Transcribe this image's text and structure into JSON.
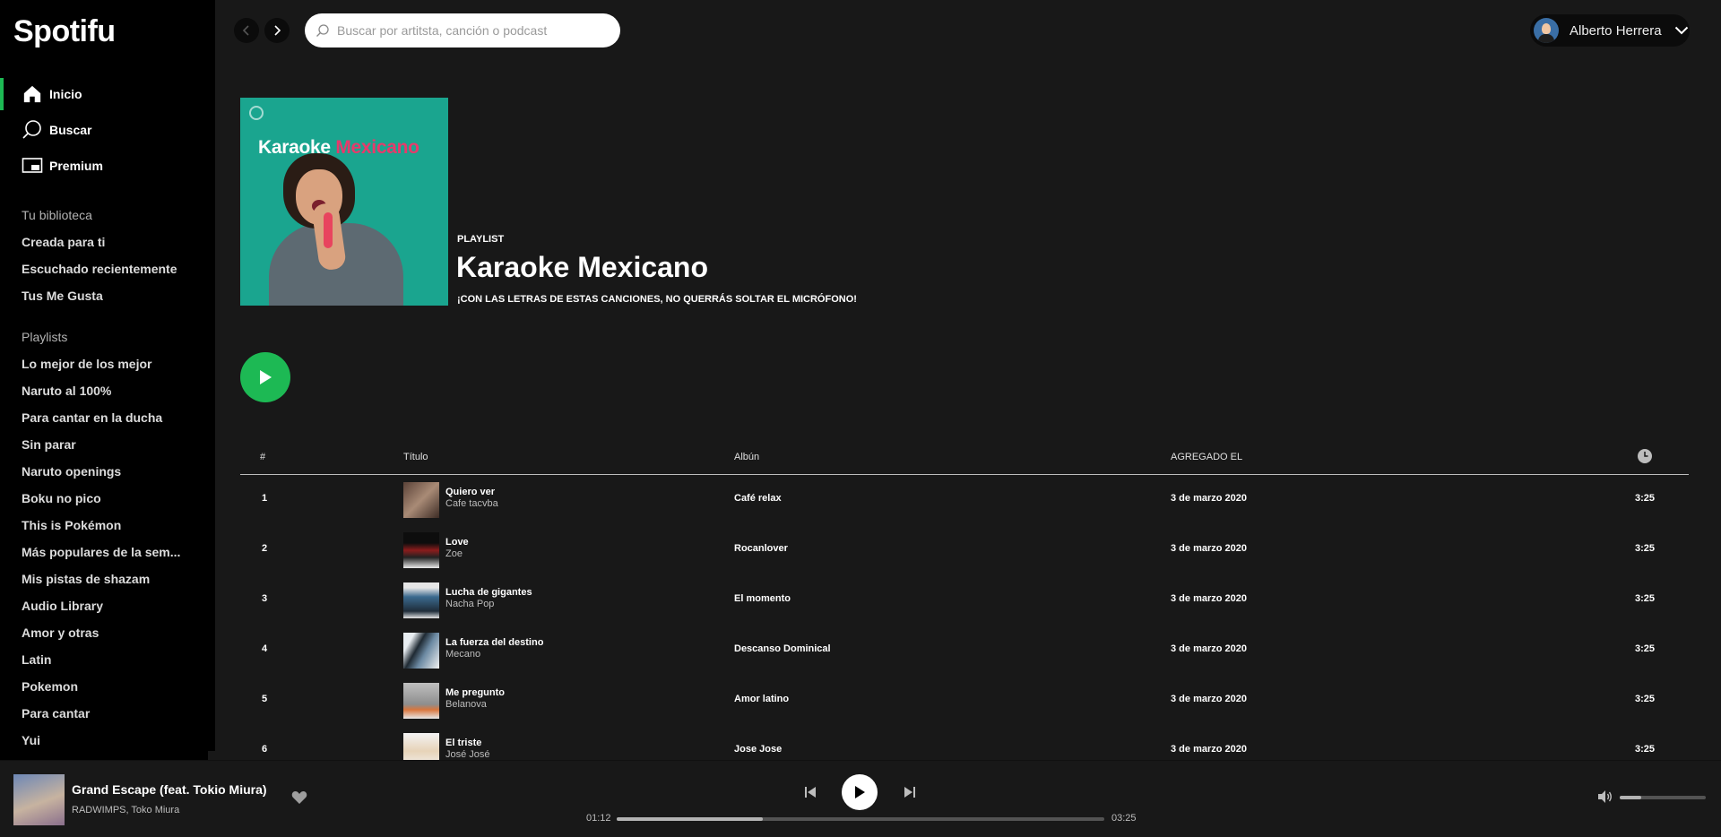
{
  "app": {
    "logo": "Spotifu"
  },
  "nav": [
    {
      "label": "Inicio",
      "icon": "home-icon",
      "active": true
    },
    {
      "label": "Buscar",
      "icon": "search-icon",
      "active": false
    },
    {
      "label": "Premium",
      "icon": "premium-icon",
      "active": false
    }
  ],
  "library": {
    "title": "Tu biblioteca",
    "items": [
      "Creada para ti",
      "Escuchado recientemente",
      "Tus Me Gusta"
    ]
  },
  "playlists": {
    "title": "Playlists",
    "items": [
      "Lo mejor de los mejor",
      "Naruto al 100%",
      "Para cantar en la ducha",
      "Sin parar",
      "Naruto openings",
      "Boku no pico",
      "This is Pokémon",
      "Más populares de la sem...",
      "Mis pistas de shazam",
      "Audio Library",
      "Amor y otras",
      "Latin",
      "Pokemon",
      "Para cantar",
      "Yui"
    ]
  },
  "search": {
    "placeholder": "Buscar por artitsta, canción o podcast"
  },
  "user": {
    "name": "Alberto Herrera"
  },
  "header": {
    "type": "PLAYLIST",
    "title": "Karaoke Mexicano",
    "description": "¡CON LAS LETRAS DE ESTAS CANCIONES, NO QUERRÁS SOLTAR EL MICRÓFONO!",
    "cover_title_white": "Karaoke",
    "cover_title_accent": "Mexicano",
    "cover_bg": "#1aa58f",
    "cover_accent": "#e63a6b"
  },
  "table": {
    "columns": {
      "num": "#",
      "title": "Título",
      "album": "Albún",
      "added": "AGREGADO EL"
    },
    "rows": [
      {
        "num": "1",
        "title": "Quiero ver",
        "artist": "Cafe tacvba",
        "album": "Café relax",
        "added": "3 de marzo 2020",
        "duration": "3:25"
      },
      {
        "num": "2",
        "title": "Love",
        "artist": "Zoe",
        "album": "Rocanlover",
        "added": "3 de marzo 2020",
        "duration": "3:25"
      },
      {
        "num": "3",
        "title": "Lucha de gigantes",
        "artist": "Nacha Pop",
        "album": "El momento",
        "added": "3 de marzo 2020",
        "duration": "3:25"
      },
      {
        "num": "4",
        "title": "La fuerza del destino",
        "artist": "Mecano",
        "album": "Descanso Dominical",
        "added": "3 de marzo 2020",
        "duration": "3:25"
      },
      {
        "num": "5",
        "title": "Me pregunto",
        "artist": "Belanova",
        "album": "Amor latino",
        "added": "3 de marzo 2020",
        "duration": "3:25"
      },
      {
        "num": "6",
        "title": "El triste",
        "artist": "José José",
        "album": "Jose Jose",
        "added": "3 de marzo 2020",
        "duration": "3:25"
      }
    ]
  },
  "player": {
    "title": "Grand Escape (feat. Tokio Miura)",
    "artist": "RADWIMPS, Toko Miura",
    "elapsed": "01:12",
    "total": "03:25",
    "progress": 0.3,
    "volume": 0.25
  },
  "colors": {
    "accent": "#1db954",
    "sidebar": "#000000",
    "background": "#181818"
  }
}
